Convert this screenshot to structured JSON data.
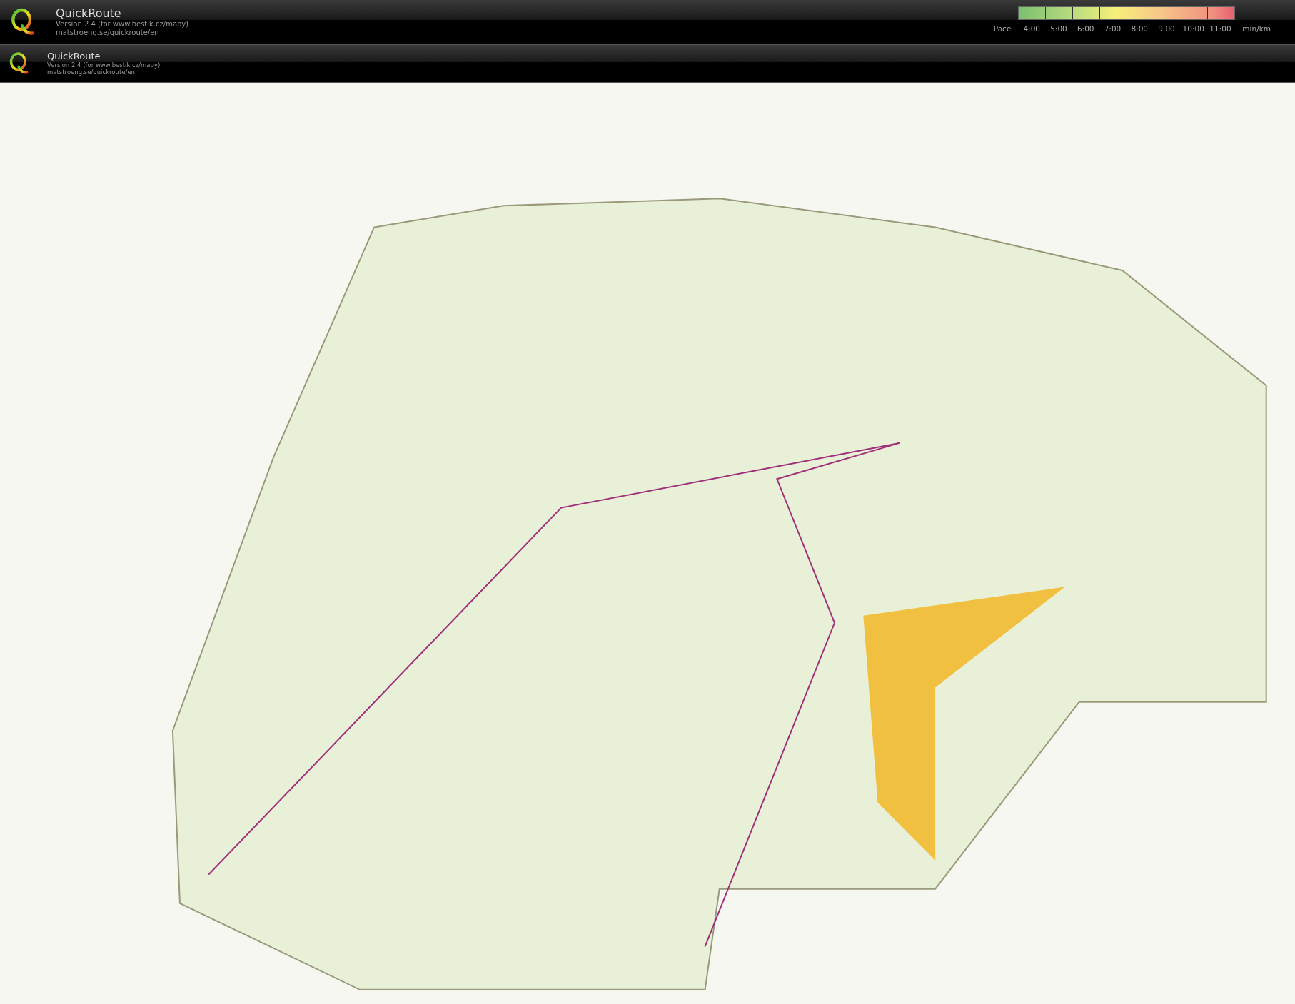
{
  "headers": [
    {
      "title": "QuickRoute",
      "version": "Version 2.4  (for www.bestik.cz/mapy)",
      "url": "matstroeng.se/quickroute/en",
      "pace_legend": {
        "label": "Pace",
        "ticks": [
          "4:00",
          "5:00",
          "6:00",
          "7:00",
          "8:00",
          "9:00",
          "10:00",
          "11:00"
        ],
        "unit": "min/km"
      }
    },
    {
      "title": "QuickRoute",
      "version": "Version 2.4  (for www.bestik.cz/mapy)",
      "url": "matstroeng.se/quickroute/en"
    }
  ]
}
